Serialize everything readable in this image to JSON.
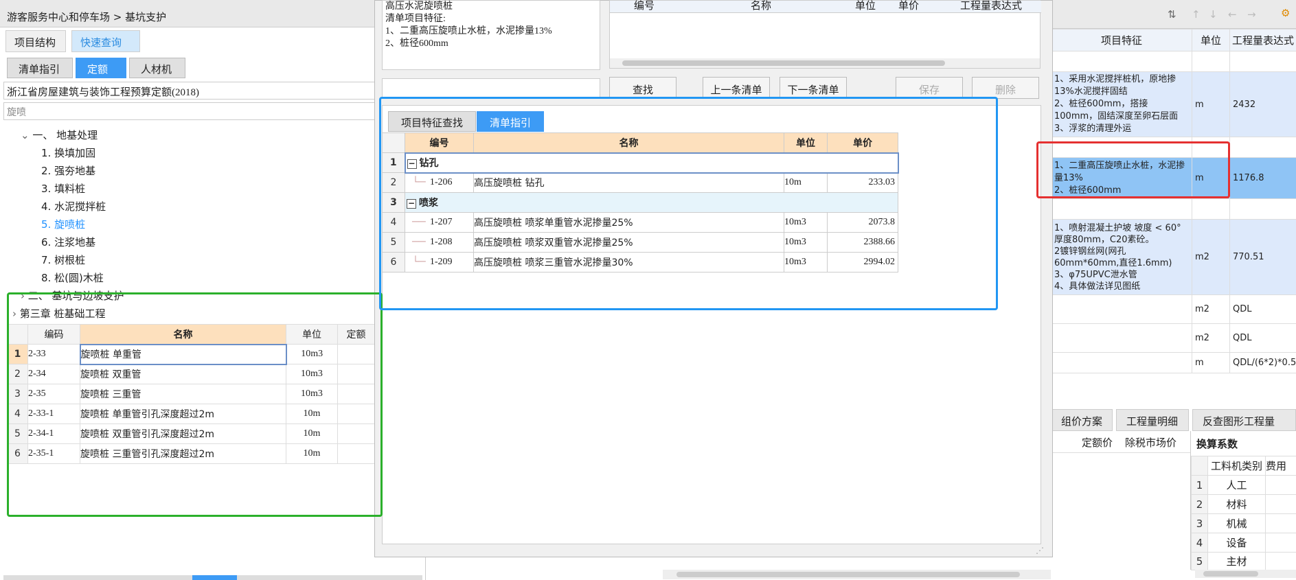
{
  "breadcrumb": "游客服务中心和停车场 > 基坑支护",
  "left": {
    "top_tabs": [
      "项目结构",
      "快速查询"
    ],
    "sub_tabs": [
      "清单指引",
      "定额",
      "人材机"
    ],
    "quota_name": "浙江省房屋建筑与装饰工程预算定额(2018)",
    "search_value": "旋喷",
    "tree": {
      "root": "一、 地基处理",
      "items": [
        "1. 换填加固",
        "2. 强夯地基",
        "3. 填料桩",
        "4. 水泥搅拌桩",
        "5. 旋喷桩",
        "6. 注浆地基",
        "7. 树根桩",
        "8. 松(圆)木桩"
      ],
      "sibling": "二、 基坑与边坡支护",
      "chapter": "第三章 桩基础工程"
    },
    "table": {
      "headers": [
        "编码",
        "名称",
        "单位",
        "定额"
      ],
      "rows": [
        {
          "n": "1",
          "code": "2-33",
          "name": "旋喷桩 单重管",
          "unit": "10m3"
        },
        {
          "n": "2",
          "code": "2-34",
          "name": "旋喷桩 双重管",
          "unit": "10m3"
        },
        {
          "n": "3",
          "code": "2-35",
          "name": "旋喷桩 三重管",
          "unit": "10m3"
        },
        {
          "n": "4",
          "code": "2-33-1",
          "name": "旋喷桩 单重管引孔深度超过2m",
          "unit": "10m"
        },
        {
          "n": "5",
          "code": "2-34-1",
          "name": "旋喷桩 双重管引孔深度超过2m",
          "unit": "10m"
        },
        {
          "n": "6",
          "code": "2-35-1",
          "name": "旋喷桩 三重管引孔深度超过2m",
          "unit": "10m"
        }
      ]
    }
  },
  "dialog": {
    "feature_text": "高压水泥旋喷桩\n清单项目特征:\n1、二重高压旋喷止水桩，水泥掺量13%\n2、桩径600mm",
    "top_headers": [
      "编号",
      "名称",
      "单位",
      "单价",
      "工程量表达式"
    ],
    "buttons": {
      "find": "查找",
      "prev": "上一条清单",
      "next": "下一条清单",
      "save": "保存",
      "delete": "删除"
    },
    "tabs": [
      "项目特征查找",
      "清单指引"
    ],
    "table": {
      "headers": [
        "编号",
        "名称",
        "单位",
        "单价"
      ],
      "groups": [
        {
          "n": "1",
          "name": "钻孔",
          "rows": [
            {
              "n": "2",
              "code": "1-206",
              "name": "高压旋喷桩 钻孔",
              "unit": "10m",
              "price": "233.03"
            }
          ]
        },
        {
          "n": "3",
          "name": "喷浆",
          "rows": [
            {
              "n": "4",
              "code": "1-207",
              "name": "高压旋喷桩 喷浆单重管水泥掺量25%",
              "unit": "10m3",
              "price": "2073.8"
            },
            {
              "n": "5",
              "code": "1-208",
              "name": "高压旋喷桩 喷浆双重管水泥掺量25%",
              "unit": "10m3",
              "price": "2388.66"
            },
            {
              "n": "6",
              "code": "1-209",
              "name": "高压旋喷桩 喷浆三重管水泥掺量30%",
              "unit": "10m3",
              "price": "2994.02"
            }
          ]
        }
      ]
    }
  },
  "right": {
    "headers": [
      "项目特征",
      "单位",
      "工程量表达式"
    ],
    "rows": [
      {
        "feature": "",
        "unit": "",
        "expr": ""
      },
      {
        "feature": "1、采用水泥搅拌桩机，原地掺13%水泥搅拌固结\n2、桩径600mm，搭接100mm，固结深度至卵石层面\n3、浮浆的清理外运",
        "unit": "m",
        "expr": "2432"
      },
      {
        "feature": "",
        "unit": "",
        "expr": ""
      },
      {
        "feature": "1、二重高压旋喷止水桩，水泥掺量13%\n2、桩径600mm",
        "unit": "m",
        "expr": "1176.8"
      },
      {
        "feature": "",
        "unit": "",
        "expr": ""
      },
      {
        "feature": "1、喷射混凝土护坡 坡度 < 60° 厚度80mm，C20素砼。\n2镀锌钢丝网(网孔60mm*60mm,直径1.6mm)\n3、φ75UPVC泄水管\n4、具体做法详见图纸",
        "unit": "m2",
        "expr": "770.51"
      },
      {
        "feature": "",
        "unit": "m2",
        "expr": "QDL"
      },
      {
        "feature": "",
        "unit": "m2",
        "expr": "QDL"
      },
      {
        "feature": "",
        "unit": "m",
        "expr": "QDL/(6*2)*0.5"
      }
    ],
    "bottom_tabs": [
      "组价方案",
      "工程量明细",
      "反查图形工程量"
    ],
    "price_headers": [
      "定额价",
      "除税市场价"
    ],
    "coef_title": "换算系数",
    "coef_headers": [
      "工料机类别",
      "费用"
    ],
    "coef_rows": [
      {
        "n": "1",
        "cat": "人工"
      },
      {
        "n": "2",
        "cat": "材料"
      },
      {
        "n": "3",
        "cat": "机械"
      },
      {
        "n": "4",
        "cat": "设备"
      },
      {
        "n": "5",
        "cat": "主材"
      }
    ]
  }
}
